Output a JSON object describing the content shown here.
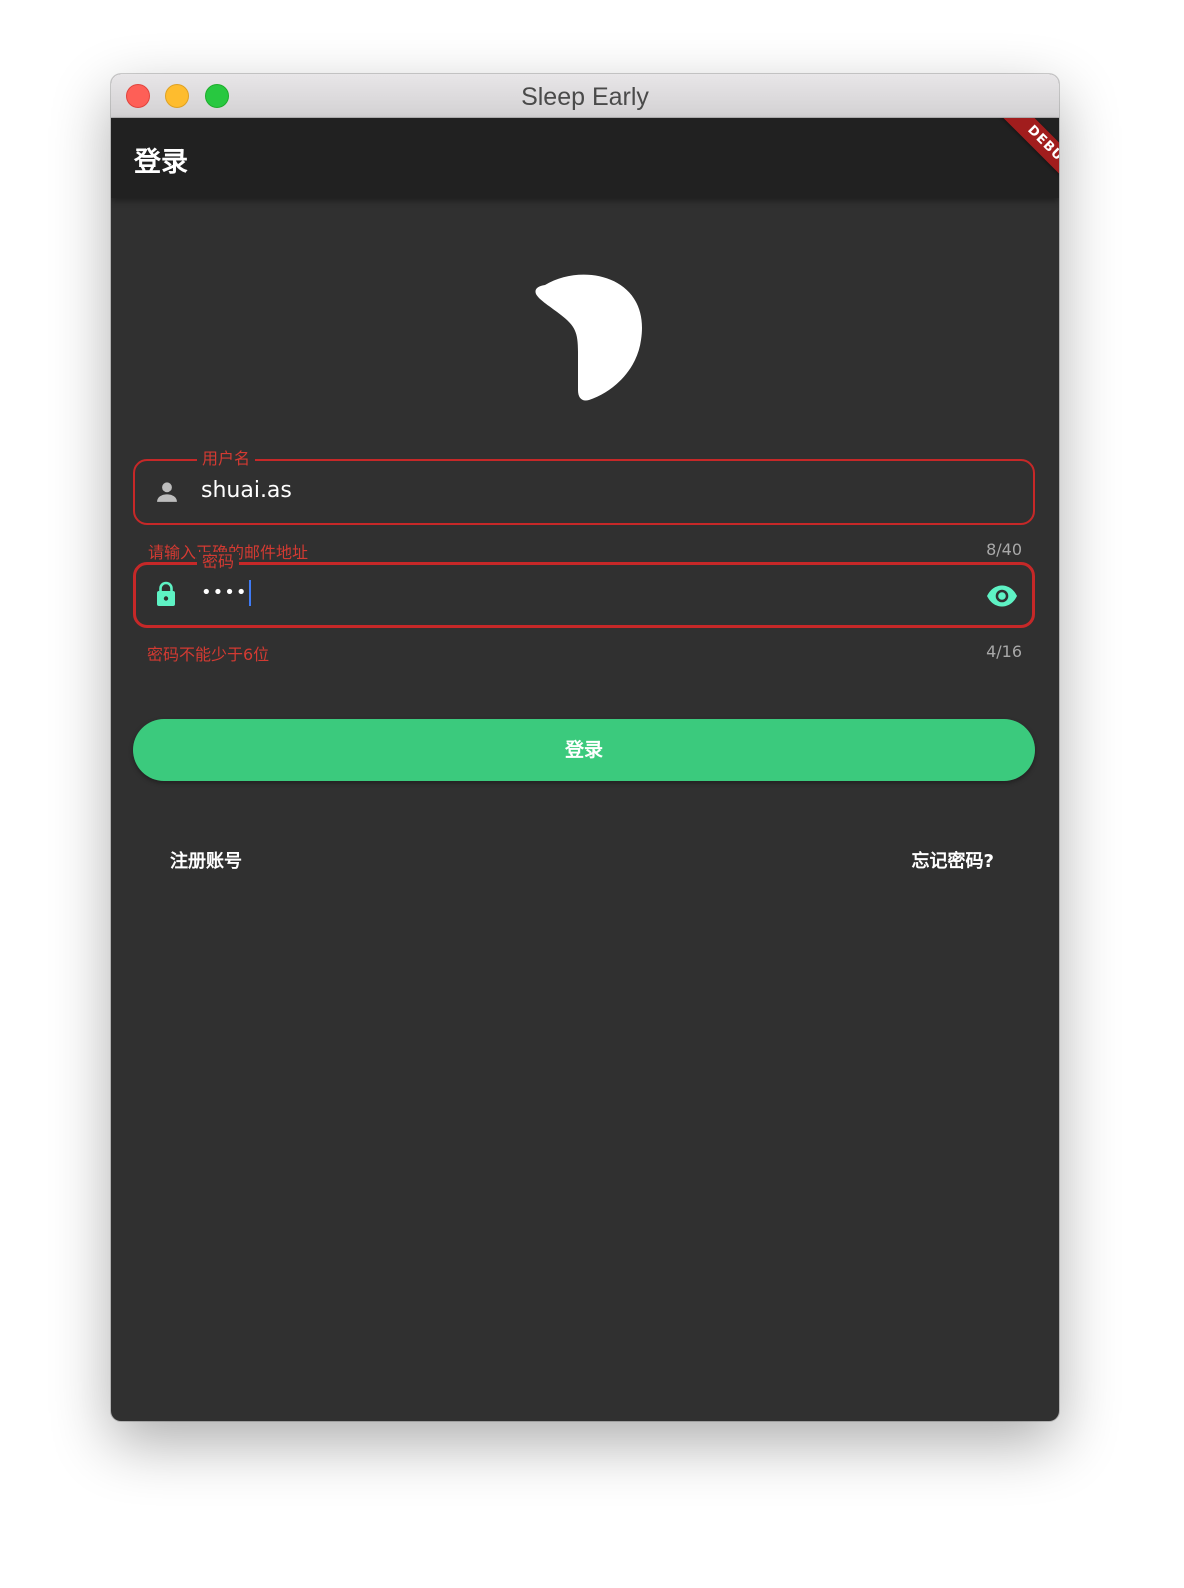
{
  "window": {
    "title": "Sleep Early"
  },
  "appbar": {
    "title": "登录",
    "debug_banner": "DEBUG"
  },
  "logo": {
    "icon": "moon-icon"
  },
  "form": {
    "username": {
      "label": "用户名",
      "value": "shuai.as",
      "error": "请输入正确的邮件地址",
      "counter": "8/40",
      "icon": "person-icon"
    },
    "password": {
      "label": "密码",
      "value": "••••",
      "error": "密码不能少于6位",
      "counter": "4/16",
      "icon": "lock-icon",
      "toggle_icon": "eye-icon"
    },
    "submit_label": "登录"
  },
  "links": {
    "register": "注册账号",
    "forgot": "忘记密码?"
  },
  "colors": {
    "accent": "#3bca7d",
    "error": "#c62828",
    "icon_active": "#5ef2c4",
    "background": "#303030",
    "appbar": "#212121"
  }
}
